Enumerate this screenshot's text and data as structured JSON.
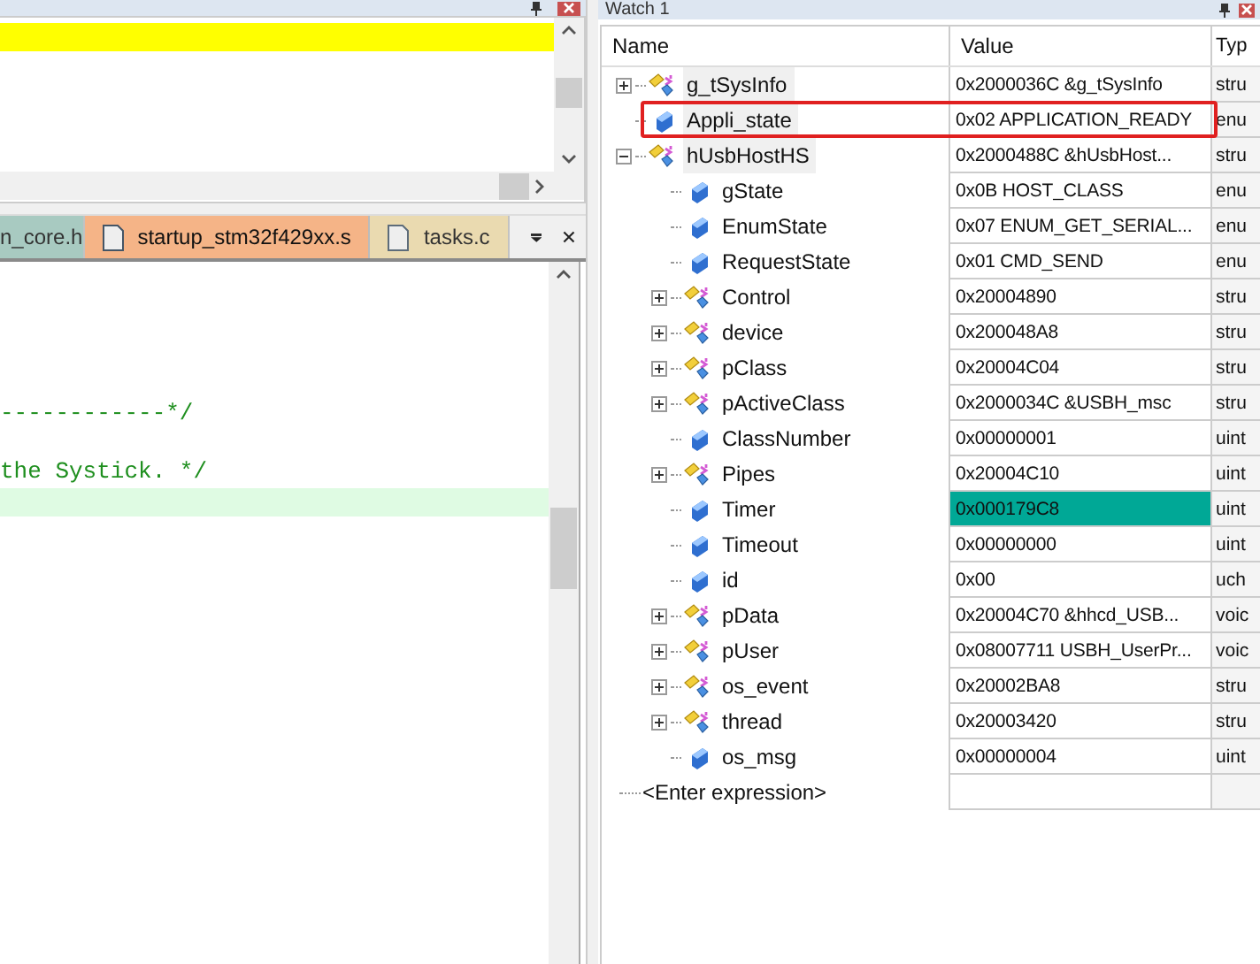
{
  "editor_tabs": [
    {
      "label": "n_core.h",
      "color": "#9cc4b9",
      "selected": false
    },
    {
      "label": "startup_stm32f429xx.s",
      "color": "#f5b487",
      "selected": true
    },
    {
      "label": "tasks.c",
      "color": "#ead7a6",
      "selected": false
    }
  ],
  "code_lines": [
    {
      "text": "------------*/",
      "highlighted": false
    },
    {
      "highlighted": false
    },
    {
      "text": "the Systick. */",
      "highlighted": false
    },
    {
      "highlighted": true
    }
  ],
  "watch": {
    "title": "Watch 1",
    "columns": [
      "Name",
      "Value",
      "Typ"
    ],
    "rows": [
      {
        "name": "g_tSysInfo",
        "value": "0x2000036C &g_tSysInfo",
        "type": "stru",
        "kind": "struct",
        "expanded": false,
        "outlined": false,
        "value_highlighted": false
      },
      {
        "name": "Appli_state",
        "value": "0x02 APPLICATION_READY",
        "type": "enu",
        "kind": "scalar",
        "outlined": true,
        "value_highlighted": false
      },
      {
        "name": "hUsbHostHS",
        "value": "0x2000488C &hUsbHost...",
        "type": "stru",
        "kind": "struct",
        "expanded": true,
        "outlined": false,
        "value_highlighted": false,
        "children": [
          {
            "name": "gState",
            "value": "0x0B HOST_CLASS",
            "type": "enu",
            "kind": "scalar",
            "outlined": false,
            "value_highlighted": false
          },
          {
            "name": "EnumState",
            "value": "0x07 ENUM_GET_SERIAL...",
            "type": "enu",
            "kind": "scalar",
            "outlined": false,
            "value_highlighted": false
          },
          {
            "name": "RequestState",
            "value": "0x01 CMD_SEND",
            "type": "enu",
            "kind": "scalar",
            "outlined": false,
            "value_highlighted": false
          },
          {
            "name": "Control",
            "value": "0x20004890",
            "type": "stru",
            "kind": "struct",
            "expanded": false,
            "outlined": false,
            "value_highlighted": false
          },
          {
            "name": "device",
            "value": "0x200048A8",
            "type": "stru",
            "kind": "struct",
            "expanded": false,
            "outlined": false,
            "value_highlighted": false
          },
          {
            "name": "pClass",
            "value": "0x20004C04",
            "type": "stru",
            "kind": "struct",
            "expanded": false,
            "outlined": false,
            "value_highlighted": false
          },
          {
            "name": "pActiveClass",
            "value": "0x2000034C &USBH_msc",
            "type": "stru",
            "kind": "struct",
            "expanded": false,
            "outlined": false,
            "value_highlighted": false
          },
          {
            "name": "ClassNumber",
            "value": "0x00000001",
            "type": "uint",
            "kind": "scalar",
            "outlined": false,
            "value_highlighted": false
          },
          {
            "name": "Pipes",
            "value": "0x20004C10",
            "type": "uint",
            "kind": "struct",
            "expanded": false,
            "outlined": false,
            "value_highlighted": false
          },
          {
            "name": "Timer",
            "value": "0x000179C8",
            "type": "uint",
            "kind": "scalar",
            "outlined": false,
            "value_highlighted": true
          },
          {
            "name": "Timeout",
            "value": "0x00000000",
            "type": "uint",
            "kind": "scalar",
            "outlined": false,
            "value_highlighted": false
          },
          {
            "name": "id",
            "value": "0x00",
            "type": "uch",
            "kind": "scalar",
            "outlined": false,
            "value_highlighted": false
          },
          {
            "name": "pData",
            "value": "0x20004C70 &hhcd_USB...",
            "type": "voic",
            "kind": "struct",
            "expanded": false,
            "outlined": false,
            "value_highlighted": false
          },
          {
            "name": "pUser",
            "value": "0x08007711 USBH_UserPr...",
            "type": "voic",
            "kind": "struct",
            "expanded": false,
            "outlined": false,
            "value_highlighted": false
          },
          {
            "name": "os_event",
            "value": "0x20002BA8",
            "type": "stru",
            "kind": "struct",
            "expanded": false,
            "outlined": false,
            "value_highlighted": false
          },
          {
            "name": "thread",
            "value": "0x20003420",
            "type": "stru",
            "kind": "struct",
            "expanded": false,
            "outlined": false,
            "value_highlighted": false
          },
          {
            "name": "os_msg",
            "value": "0x00000004",
            "type": "uint",
            "kind": "scalar",
            "outlined": false,
            "value_highlighted": false
          }
        ]
      }
    ],
    "placeholder": "<Enter expression>"
  }
}
